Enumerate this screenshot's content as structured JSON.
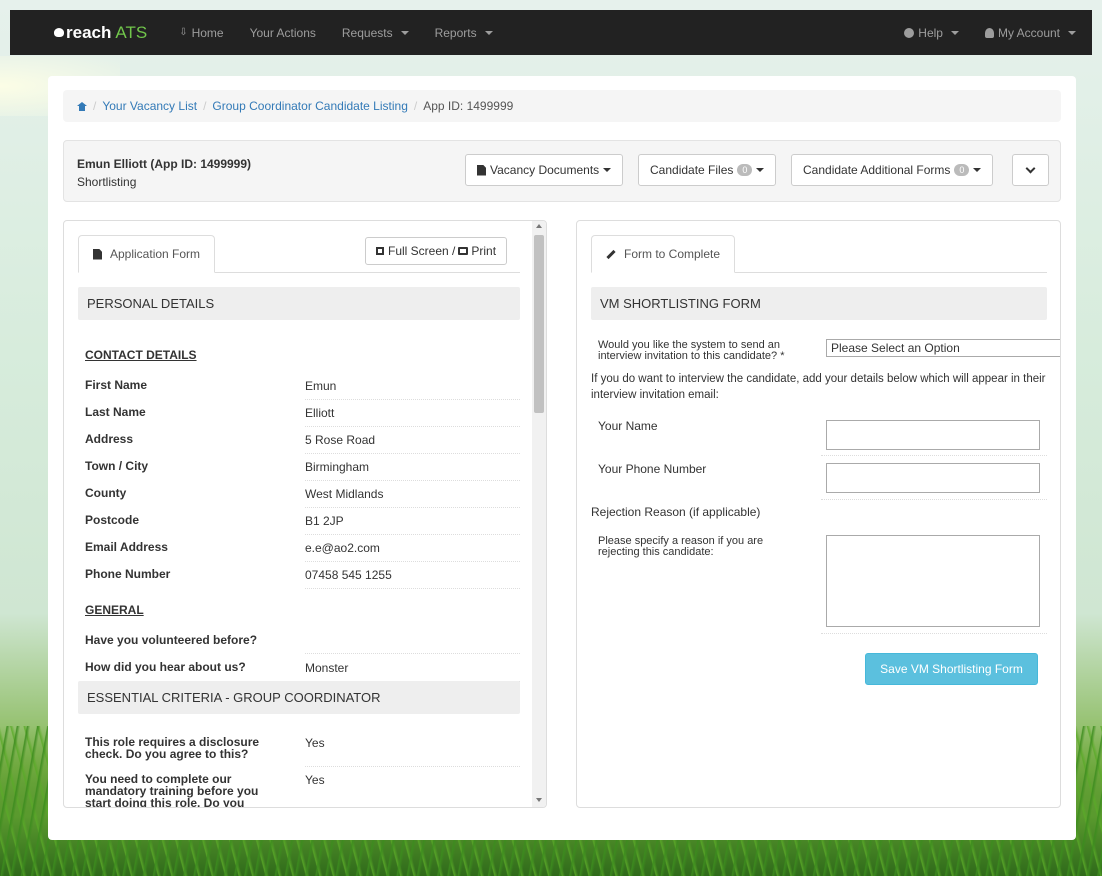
{
  "navbar": {
    "brand_main": "reach",
    "brand_accent": "ATS",
    "items": [
      {
        "label": "Home",
        "icon": "home-icon"
      },
      {
        "label": "Your Actions"
      },
      {
        "label": "Requests"
      },
      {
        "label": "Reports"
      }
    ],
    "right": [
      {
        "label": "Help",
        "icon": "info-icon"
      },
      {
        "label": "My Account",
        "icon": "user-icon"
      }
    ]
  },
  "breadcrumb": {
    "links": [
      "Your Vacancy List",
      "Group Coordinator Candidate Listing"
    ],
    "current": "App ID: 1499999"
  },
  "header": {
    "candidate": "Emun Elliott (App ID: 1499999)",
    "stage": "Shortlisting",
    "buttons": {
      "vacancy_documents": "Vacancy Documents",
      "candidate_files": "Candidate Files",
      "candidate_files_count": "0",
      "additional_forms": "Candidate Additional Forms",
      "additional_forms_count": "0"
    }
  },
  "left": {
    "tab": "Application Form",
    "fullscreen": "Full Screen / ",
    "print": "Print",
    "section_personal": "PERSONAL DETAILS",
    "contact_heading": "CONTACT DETAILS",
    "contact_fields": [
      {
        "label": "First Name",
        "value": "Emun"
      },
      {
        "label": "Last Name",
        "value": "Elliott"
      },
      {
        "label": "Address",
        "value": "5 Rose Road"
      },
      {
        "label": "Town / City",
        "value": "Birmingham"
      },
      {
        "label": "County",
        "value": "West Midlands"
      },
      {
        "label": "Postcode",
        "value": "B1 2JP"
      },
      {
        "label": "Email Address",
        "value": "e.e@ao2.com"
      },
      {
        "label": "Phone Number",
        "value": "07458 545 1255"
      }
    ],
    "general_heading": "GENERAL",
    "general_fields": [
      {
        "label": "Have you volunteered before?",
        "value": ""
      },
      {
        "label": "How did you hear about us?",
        "value": "Monster"
      }
    ],
    "section_essential": "ESSENTIAL CRITERIA - GROUP COORDINATOR",
    "essential_fields": [
      {
        "label": "This role requires a disclosure check. Do you agree to this?",
        "value": "Yes"
      },
      {
        "label": "You need to complete our mandatory training before you start doing this role. Do you agree to",
        "value": "Yes"
      }
    ]
  },
  "right": {
    "tab": "Form to Complete",
    "section": "VM SHORTLISTING FORM",
    "invite_question": "Would you like the system to send an interview invitation to this candidate? *",
    "invite_select": "Please Select an Option",
    "note": "If you do want to interview the candidate, add your details below which will appear in their interview invitation email:",
    "your_name_label": "Your Name",
    "your_phone_label": "Your Phone Number",
    "rejection_title": "Rejection Reason (if applicable)",
    "rejection_label": "Please specify a reason if you are rejecting this candidate:",
    "save_label": "Save VM Shortlisting Form"
  }
}
